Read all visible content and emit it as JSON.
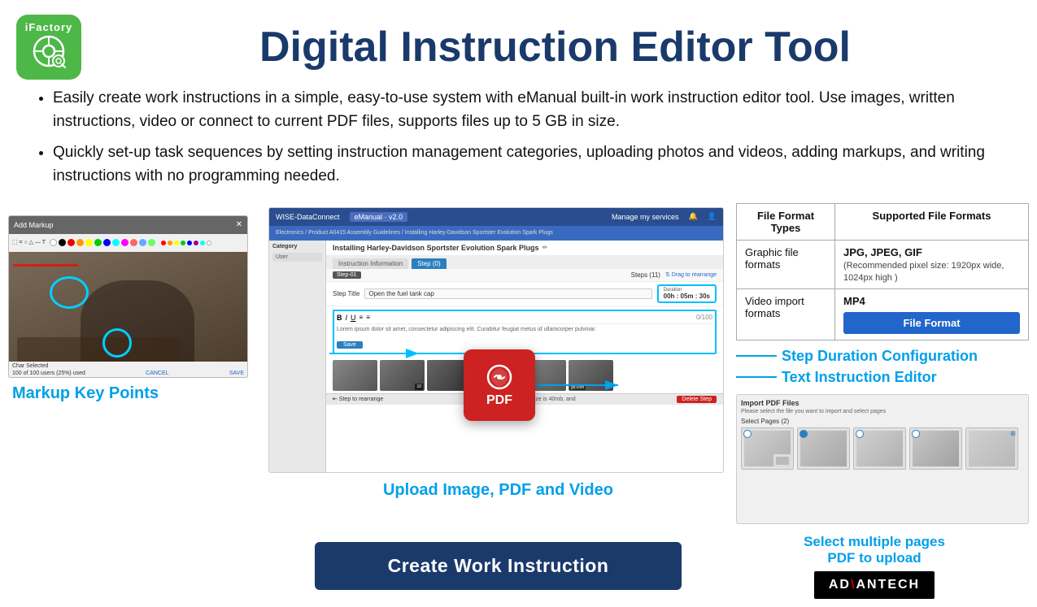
{
  "page": {
    "title": "Digital Instruction Editor Tool"
  },
  "logo": {
    "brand": "iFactory",
    "icon": "⚙"
  },
  "bullets": [
    "Easily create work instructions in a simple, easy-to-use system with eManual built-in work instruction editor tool. Use images, written instructions, video or connect to current PDF files, supports files up to 5 GB in size.",
    "Quickly set-up task sequences by setting instruction management categories, uploading photos and videos, adding markups, and writing instructions with no programming needed."
  ],
  "table": {
    "col1": "File Format Types",
    "col2": "Supported File Formats",
    "rows": [
      {
        "type": "Graphic file formats",
        "formats": "JPG, JPEG, GIF",
        "note": "(Recommended pixel size: 1920px wide, 1024px high )"
      },
      {
        "type": "Video import formats",
        "formats": "MP4",
        "note": ""
      }
    ],
    "btn": "File Format"
  },
  "callouts": {
    "step_duration": "Step Duration Configuration",
    "text_editor": "Text Instruction Editor"
  },
  "upload_label": "Upload Image, PDF and Video",
  "create_btn": "Create Work Instruction",
  "markup_label": "Markup Key Points",
  "select_label": "Select multiple pages\nPDF to upload",
  "editor": {
    "topbar": "WISE-DataConnect",
    "app": "eManual - v2.0",
    "breadcrumb": "Electronics / Product A0415 Assembly Guidelines / Installing Harley-Davidson Sportster Evolution Spark Plugs",
    "title": "Installing Harley-Davidson Sportster Evolution Spark Plugs",
    "tabs": [
      "Instruction Information",
      "Step (0)"
    ],
    "step": "Step-01",
    "steps_count": "Steps (11)",
    "step_title": "Open the fuel tank cap",
    "duration": "00h : 05m : 30s",
    "text_placeholder": "Lorem ipsum dolor sit amet, consectetur adipiscing elit. Curabitur feugiat metus id ullamcorper pulvinar.",
    "save_btn": "Save",
    "toolbar": "B I U"
  },
  "pdf_pages_panel": {
    "title": "Import PDF Files",
    "subtitle": "Please select the file you want to import and select pages",
    "select_pages_label": "Select Pages (2)"
  },
  "advantech": {
    "brand": "AD\\ANTECH"
  },
  "colors": {
    "accent_blue": "#00a0e9",
    "dark_navy": "#1a3a6b",
    "button_blue": "#2266cc",
    "pdf_red": "#cc2222"
  }
}
